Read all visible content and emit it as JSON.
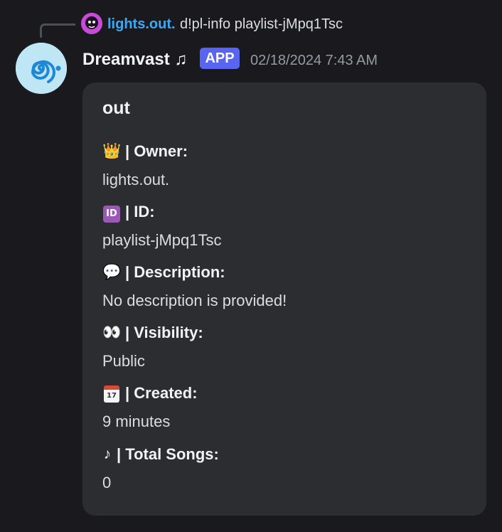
{
  "reply": {
    "username": "lights.out.",
    "command": "d!pl-info playlist-jMpq1Tsc"
  },
  "message": {
    "author": "Dreamvast ♫",
    "badge": "APP",
    "timestamp": "02/18/2024 7:43 AM"
  },
  "embed": {
    "title": "out",
    "fields": [
      {
        "emoji": "👑",
        "name": "| Owner:",
        "value": "lights.out."
      },
      {
        "emoji": "ID",
        "name": "| ID:",
        "value": "playlist-jMpq1Tsc"
      },
      {
        "emoji": "💬",
        "name": "| Description:",
        "value": "No description is provided!"
      },
      {
        "emoji": "👀",
        "name": "| Visibility:",
        "value": "Public"
      },
      {
        "emoji": "17",
        "name": "| Created:",
        "value": "9 minutes"
      },
      {
        "emoji": "♪",
        "name": "| Total Songs:",
        "value": "0"
      }
    ]
  },
  "colors": {
    "background": "#1a1a1e",
    "embed_background": "#2b2d31",
    "reply_username": "#3ea8f5",
    "app_badge": "#5865f2",
    "timestamp": "#949ba4",
    "avatar": "#bfe6f5",
    "avatar_icon": "#1e88d6"
  },
  "icons": {
    "reply_connector": "reply-line-icon",
    "reply_avatar": "reply-avatar",
    "bot_avatar": "spiral-icon"
  }
}
